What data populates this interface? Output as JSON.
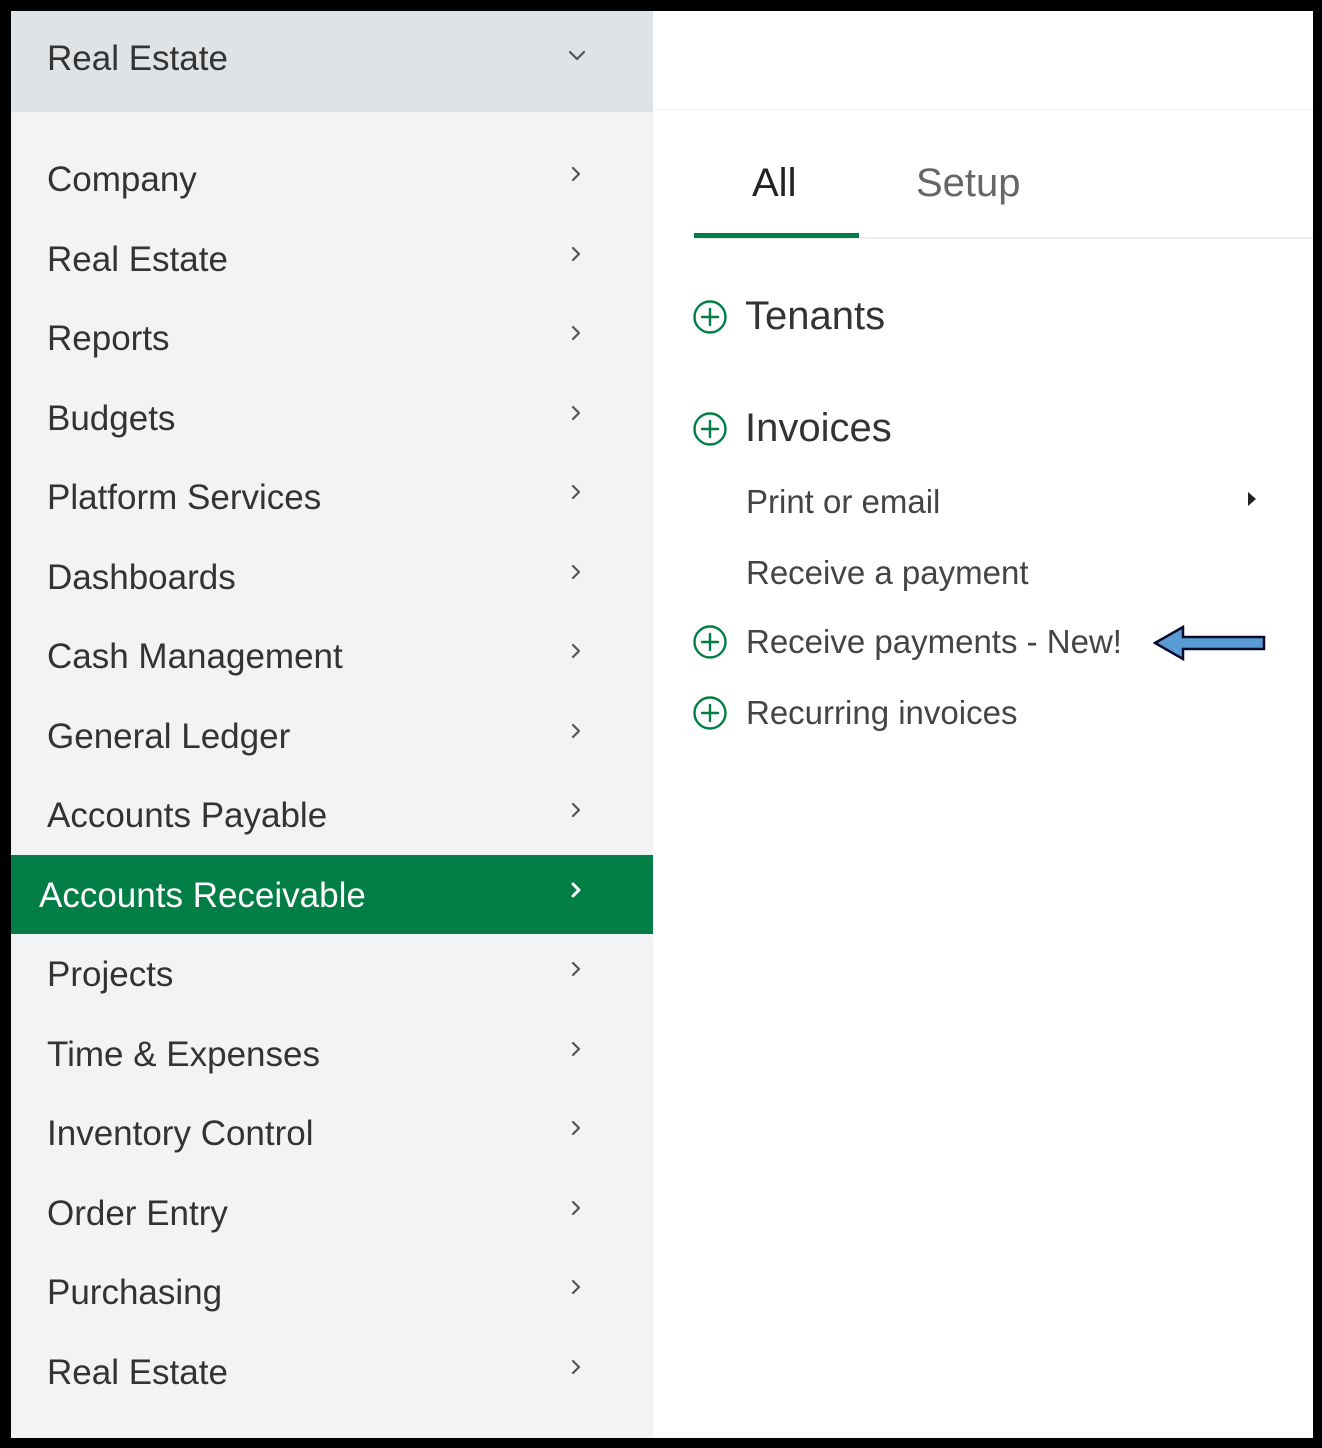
{
  "sidebar": {
    "header": {
      "label": "Real Estate",
      "icon": "chevron-down-icon"
    },
    "items": [
      {
        "label": "Company",
        "active": false
      },
      {
        "label": "Real Estate",
        "active": false
      },
      {
        "label": "Reports",
        "active": false
      },
      {
        "label": "Budgets",
        "active": false
      },
      {
        "label": "Platform Services",
        "active": false
      },
      {
        "label": "Dashboards",
        "active": false
      },
      {
        "label": "Cash Management",
        "active": false
      },
      {
        "label": "General Ledger",
        "active": false
      },
      {
        "label": "Accounts Payable",
        "active": false
      },
      {
        "label": "Accounts Receivable",
        "active": true
      },
      {
        "label": "Projects",
        "active": false
      },
      {
        "label": "Time & Expenses",
        "active": false
      },
      {
        "label": "Inventory Control",
        "active": false
      },
      {
        "label": "Order Entry",
        "active": false
      },
      {
        "label": "Purchasing",
        "active": false
      },
      {
        "label": "Real Estate",
        "active": false
      }
    ]
  },
  "tabs": [
    {
      "label": "All",
      "selected": true
    },
    {
      "label": "Setup",
      "selected": false
    }
  ],
  "sections": {
    "tenants": {
      "label": "Tenants"
    },
    "invoices": {
      "label": "Invoices",
      "items": {
        "print_or_email": "Print or email",
        "receive_a_payment": "Receive a payment",
        "receive_payments_new": "Receive payments - New!",
        "recurring_invoices": "Recurring invoices"
      }
    }
  },
  "colors": {
    "accent": "#007e45",
    "sidebar_bg": "#f1f3f4",
    "sidebar_header_bg": "#dfe3e6",
    "annotation_arrow": "#5b9bd5"
  }
}
